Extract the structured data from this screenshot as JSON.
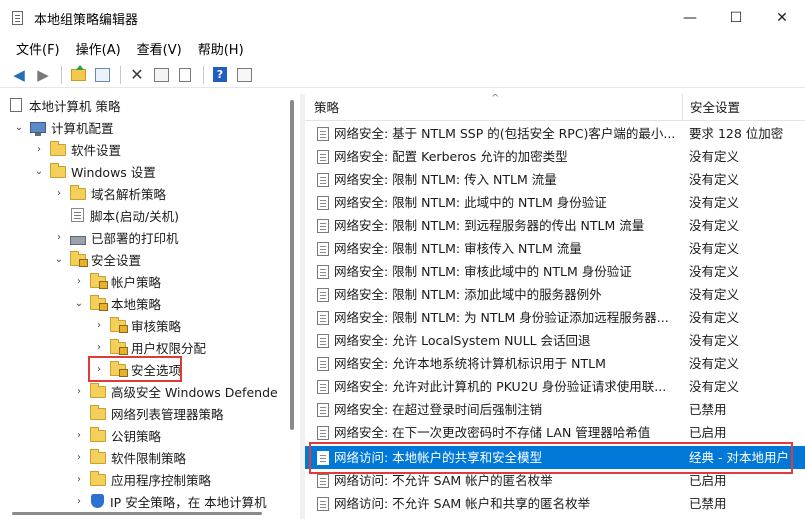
{
  "window": {
    "title": "本地组策略编辑器",
    "controls": {
      "minimize": "—",
      "maximize": "☐",
      "close": "✕"
    }
  },
  "menu": [
    "文件(F)",
    "操作(A)",
    "查看(V)",
    "帮助(H)"
  ],
  "toolbar": {
    "icons": [
      "back-arrow-icon",
      "forward-arrow-icon",
      "up-folder-icon",
      "show-hide-tree-icon",
      "delete-icon",
      "properties-icon",
      "export-list-icon",
      "help-icon",
      "view-icon"
    ]
  },
  "tree": {
    "root": "本地计算机 策略",
    "items": [
      {
        "label": "计算机配置",
        "icon": "computer-icon",
        "twisty": "⌄"
      },
      {
        "label": "软件设置",
        "icon": "folder-icon",
        "twisty": "›"
      },
      {
        "label": "Windows 设置",
        "icon": "folder-icon",
        "twisty": "⌄"
      },
      {
        "label": "域名解析策略",
        "icon": "folder-icon",
        "twisty": "›"
      },
      {
        "label": "脚本(启动/关机)",
        "icon": "script-icon",
        "twisty": ""
      },
      {
        "label": "已部署的打印机",
        "icon": "printer-icon",
        "twisty": "›"
      },
      {
        "label": "安全设置",
        "icon": "security-settings-icon",
        "twisty": "⌄"
      },
      {
        "label": "帐户策略",
        "icon": "locked-folder-icon",
        "twisty": "›"
      },
      {
        "label": "本地策略",
        "icon": "locked-folder-icon",
        "twisty": "⌄"
      },
      {
        "label": "审核策略",
        "icon": "locked-folder-icon",
        "twisty": "›"
      },
      {
        "label": "用户权限分配",
        "icon": "locked-folder-icon",
        "twisty": "›"
      },
      {
        "label": "安全选项",
        "icon": "locked-folder-icon",
        "twisty": "›"
      },
      {
        "label": "高级安全 Windows Defende",
        "icon": "folder-icon",
        "twisty": "›"
      },
      {
        "label": "网络列表管理器策略",
        "icon": "folder-icon",
        "twisty": ""
      },
      {
        "label": "公钥策略",
        "icon": "folder-icon",
        "twisty": "›"
      },
      {
        "label": "软件限制策略",
        "icon": "folder-icon",
        "twisty": "›"
      },
      {
        "label": "应用程序控制策略",
        "icon": "folder-icon",
        "twisty": "›"
      },
      {
        "label": "IP 安全策略，在 本地计算机",
        "icon": "shield-icon",
        "twisty": "›"
      }
    ]
  },
  "list": {
    "columns": {
      "policy": "策略",
      "setting": "安全设置",
      "sort_indicator": "^"
    },
    "rows": [
      {
        "name": "网络安全: 基于 NTLM SSP 的(包括安全 RPC)客户端的最小...",
        "value": "要求 128 位加密"
      },
      {
        "name": "网络安全: 配置 Kerberos 允许的加密类型",
        "value": "没有定义"
      },
      {
        "name": "网络安全: 限制 NTLM: 传入 NTLM 流量",
        "value": "没有定义"
      },
      {
        "name": "网络安全: 限制 NTLM: 此域中的 NTLM 身份验证",
        "value": "没有定义"
      },
      {
        "name": "网络安全: 限制 NTLM: 到远程服务器的传出 NTLM 流量",
        "value": "没有定义"
      },
      {
        "name": "网络安全: 限制 NTLM: 审核传入 NTLM 流量",
        "value": "没有定义"
      },
      {
        "name": "网络安全: 限制 NTLM: 审核此域中的 NTLM 身份验证",
        "value": "没有定义"
      },
      {
        "name": "网络安全: 限制 NTLM: 添加此域中的服务器例外",
        "value": "没有定义"
      },
      {
        "name": "网络安全: 限制 NTLM: 为 NTLM 身份验证添加远程服务器...",
        "value": "没有定义"
      },
      {
        "name": "网络安全: 允许 LocalSystem NULL 会话回退",
        "value": "没有定义"
      },
      {
        "name": "网络安全: 允许本地系统将计算机标识用于 NTLM",
        "value": "没有定义"
      },
      {
        "name": "网络安全: 允许对此计算机的 PKU2U 身份验证请求使用联...",
        "value": "没有定义"
      },
      {
        "name": "网络安全: 在超过登录时间后强制注销",
        "value": "已禁用"
      },
      {
        "name": "网络安全: 在下一次更改密码时不存储 LAN 管理器哈希值",
        "value": "已启用"
      },
      {
        "name": "网络访问: 本地帐户的共享和安全模型",
        "value": "经典 - 对本地用户"
      },
      {
        "name": "网络访问: 不允许 SAM 帐户的匿名枚举",
        "value": "已启用"
      },
      {
        "name": "网络访问: 不允许 SAM 帐户和共享的匿名枚举",
        "value": "已禁用"
      }
    ],
    "selected_row": 14
  },
  "colors": {
    "selection": "#0078d7",
    "highlight_box": "#e03a3a"
  }
}
